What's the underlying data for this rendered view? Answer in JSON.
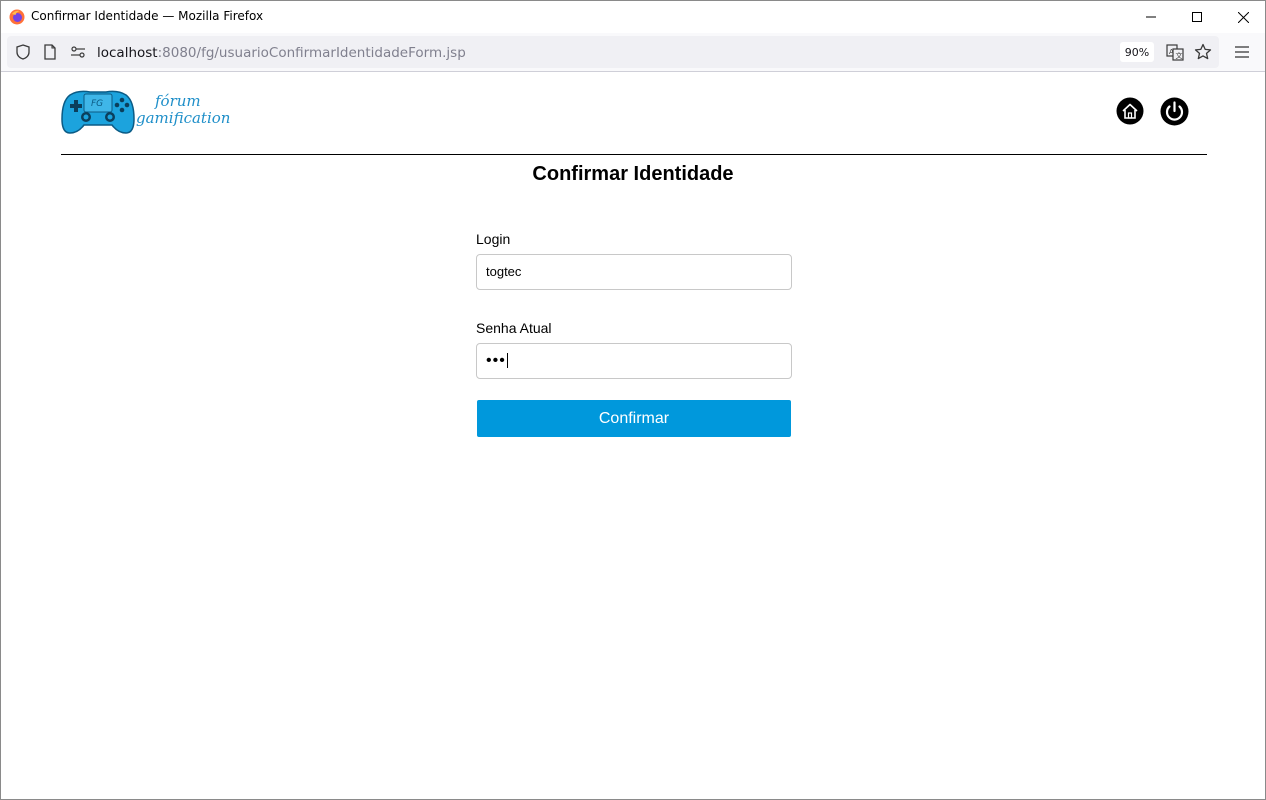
{
  "window": {
    "title": "Confirmar Identidade — Mozilla Firefox"
  },
  "navbar": {
    "url_host": "localhost",
    "url_rest": ":8080/fg/usuarioConfirmarIdentidadeForm.jsp",
    "zoom": "90%"
  },
  "header": {
    "logo_badge": "FG",
    "logo_line1": "fórum",
    "logo_line2": "gamification"
  },
  "page": {
    "title": "Confirmar Identidade"
  },
  "form": {
    "login_label": "Login",
    "login_value": "togtec",
    "password_label": "Senha Atual",
    "password_masked": "•••",
    "submit_label": "Confirmar"
  },
  "colors": {
    "accent": "#0098dc",
    "logo_blue": "#1f8fc9"
  }
}
